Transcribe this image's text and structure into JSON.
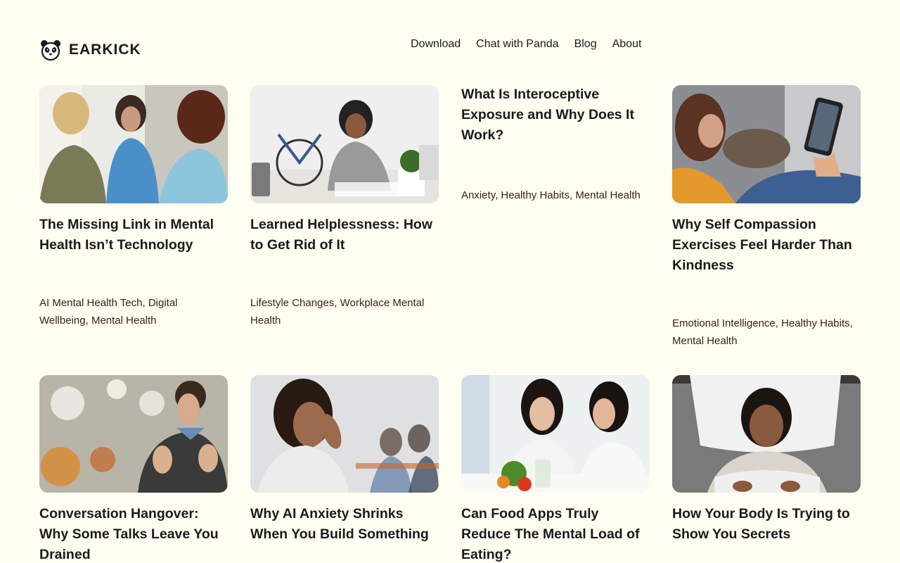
{
  "brand": {
    "name": "EARKICK"
  },
  "nav": {
    "items": [
      {
        "label": "Download"
      },
      {
        "label": "Chat with Panda"
      },
      {
        "label": "Blog"
      },
      {
        "label": "About"
      }
    ]
  },
  "posts": [
    {
      "title": "The Missing Link in Mental Health Isn’t Technology",
      "tags": [
        "AI Mental Health Tech",
        "Digital Wellbeing",
        "Mental Health"
      ]
    },
    {
      "title": "Learned Helplessness: How to Get Rid of It",
      "tags": [
        "Lifestyle Changes",
        "Workplace Mental Health"
      ]
    },
    {
      "title": "What Is Interoceptive Exposure and Why Does It Work?",
      "tags": [
        "Anxiety",
        "Healthy Habits",
        "Mental Health"
      ]
    },
    {
      "title": "Why Self Compassion Exercises Feel Harder Than Kindness",
      "tags": [
        "Emotional Intelligence",
        "Healthy Habits",
        "Mental Health"
      ]
    },
    {
      "title": "Conversation Hangover: Why Some Talks Leave You Drained",
      "tags": []
    },
    {
      "title": "Why AI Anxiety Shrinks When You Build Something",
      "tags": []
    },
    {
      "title": "Can Food Apps Truly Reduce The Mental Load of Eating?",
      "tags": []
    },
    {
      "title": "How Your Body Is Trying to Show You Secrets",
      "tags": []
    }
  ],
  "tag_separator": ", "
}
